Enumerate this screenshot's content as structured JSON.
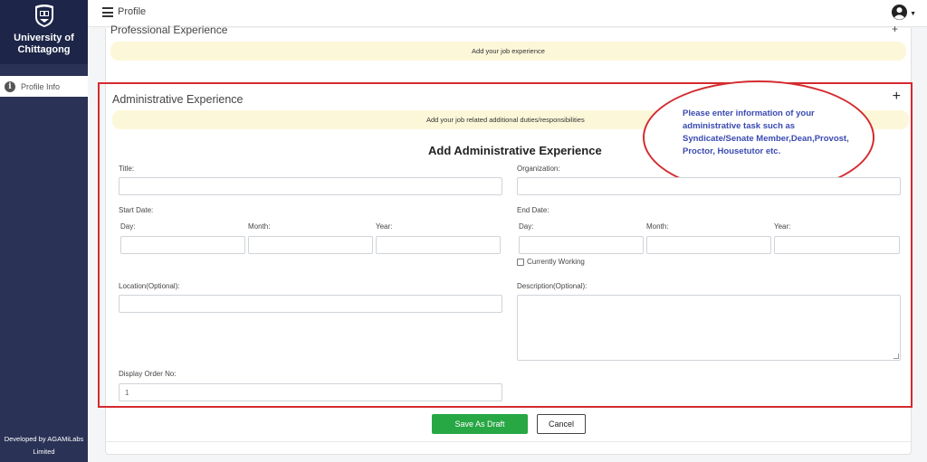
{
  "sidebar": {
    "brand": "University of Chittagong",
    "items": [
      {
        "label": "Profile Info",
        "icon": "info-icon"
      }
    ],
    "footer": "Developed by AGAMiLabs Limited"
  },
  "topbar": {
    "title": "Profile",
    "menu_icon": "hamburger-icon",
    "user_icon": "user-circle-icon"
  },
  "professional": {
    "title": "Professional Experience",
    "banner": "Add your job experience"
  },
  "administrative": {
    "title": "Administrative Experience",
    "expand": "+",
    "banner": "Add your job related additional duties/responsibilities",
    "annotation": "Please enter information of your administrative task such as Syndicate/Senate Member,Dean,Provost, Proctor, Housetutor etc.",
    "form_title": "Add Administrative Experience",
    "fields": {
      "title_label": "Title:",
      "title_value": "",
      "organization_label": "Organization:",
      "organization_value": "",
      "start_date_label": "Start Date:",
      "end_date_label": "End Date:",
      "day_label": "Day:",
      "month_label": "Month:",
      "year_label": "Year:",
      "currently_working_label": "Currently Working",
      "currently_working_checked": false,
      "location_label": "Location(Optional):",
      "location_value": "",
      "description_label": "Description(Optional):",
      "description_value": "",
      "display_order_label": "Display Order No:",
      "display_order_value": "1"
    }
  },
  "actions": {
    "save_label": "Save As Draft",
    "cancel_label": "Cancel"
  },
  "colors": {
    "sidebar": "#2a3356",
    "sidebar_brand": "#1d2648",
    "banner": "#fdf7d9",
    "annotation_border": "#d42b2f",
    "annotation_text": "#3a4ab2",
    "save_button": "#28a745"
  }
}
